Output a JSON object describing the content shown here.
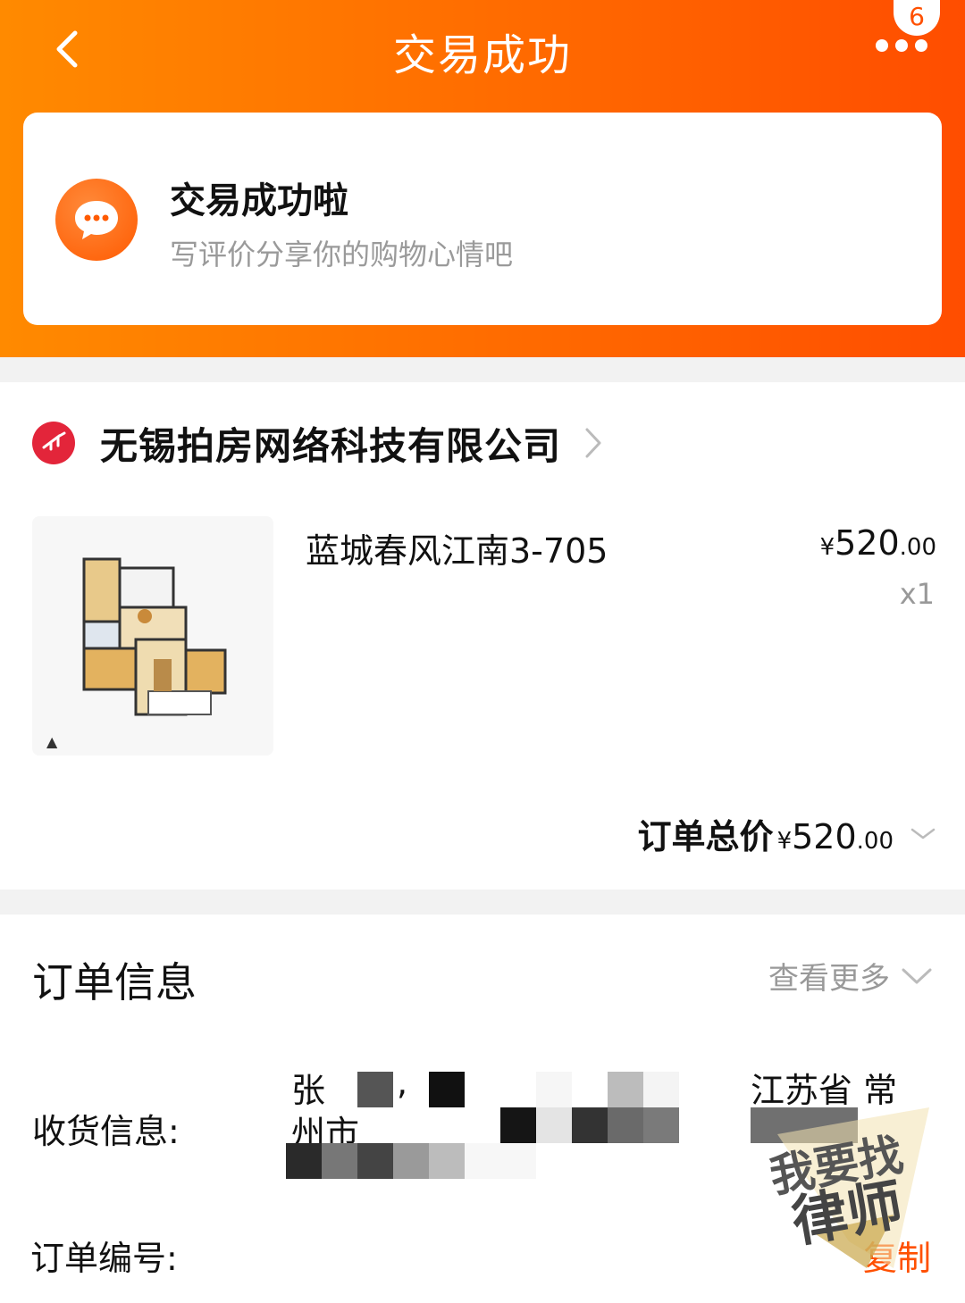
{
  "nav": {
    "title": "交易成功",
    "badge_count": "6"
  },
  "status_card": {
    "title": "交易成功啦",
    "subtitle": "写评价分享你的购物心情吧"
  },
  "shop": {
    "name": "无锡拍房网络科技有限公司"
  },
  "product": {
    "title": "蓝城春风江南3-705",
    "currency": "¥",
    "price_int": "520",
    "price_dec": ".00",
    "quantity": "x1"
  },
  "order_total": {
    "label": "订单总价",
    "currency": "¥",
    "value_int": "520",
    "value_dec": ".00"
  },
  "order_info": {
    "title": "订单信息",
    "more_label": "查看更多",
    "shipping_label": "收货信息:",
    "shipping_line1_a": "张",
    "shipping_line1_b": ",",
    "shipping_line1_c": "江苏省 常",
    "shipping_line2_a": "州市",
    "order_no_label": "订单编号:",
    "copy_label": "复制"
  },
  "watermark": {
    "text_line1": "我要找",
    "text_line2": "律师"
  },
  "colors": {
    "accent": "#ff5000",
    "header_start": "#ff8a00",
    "header_end": "#ff4d00"
  }
}
